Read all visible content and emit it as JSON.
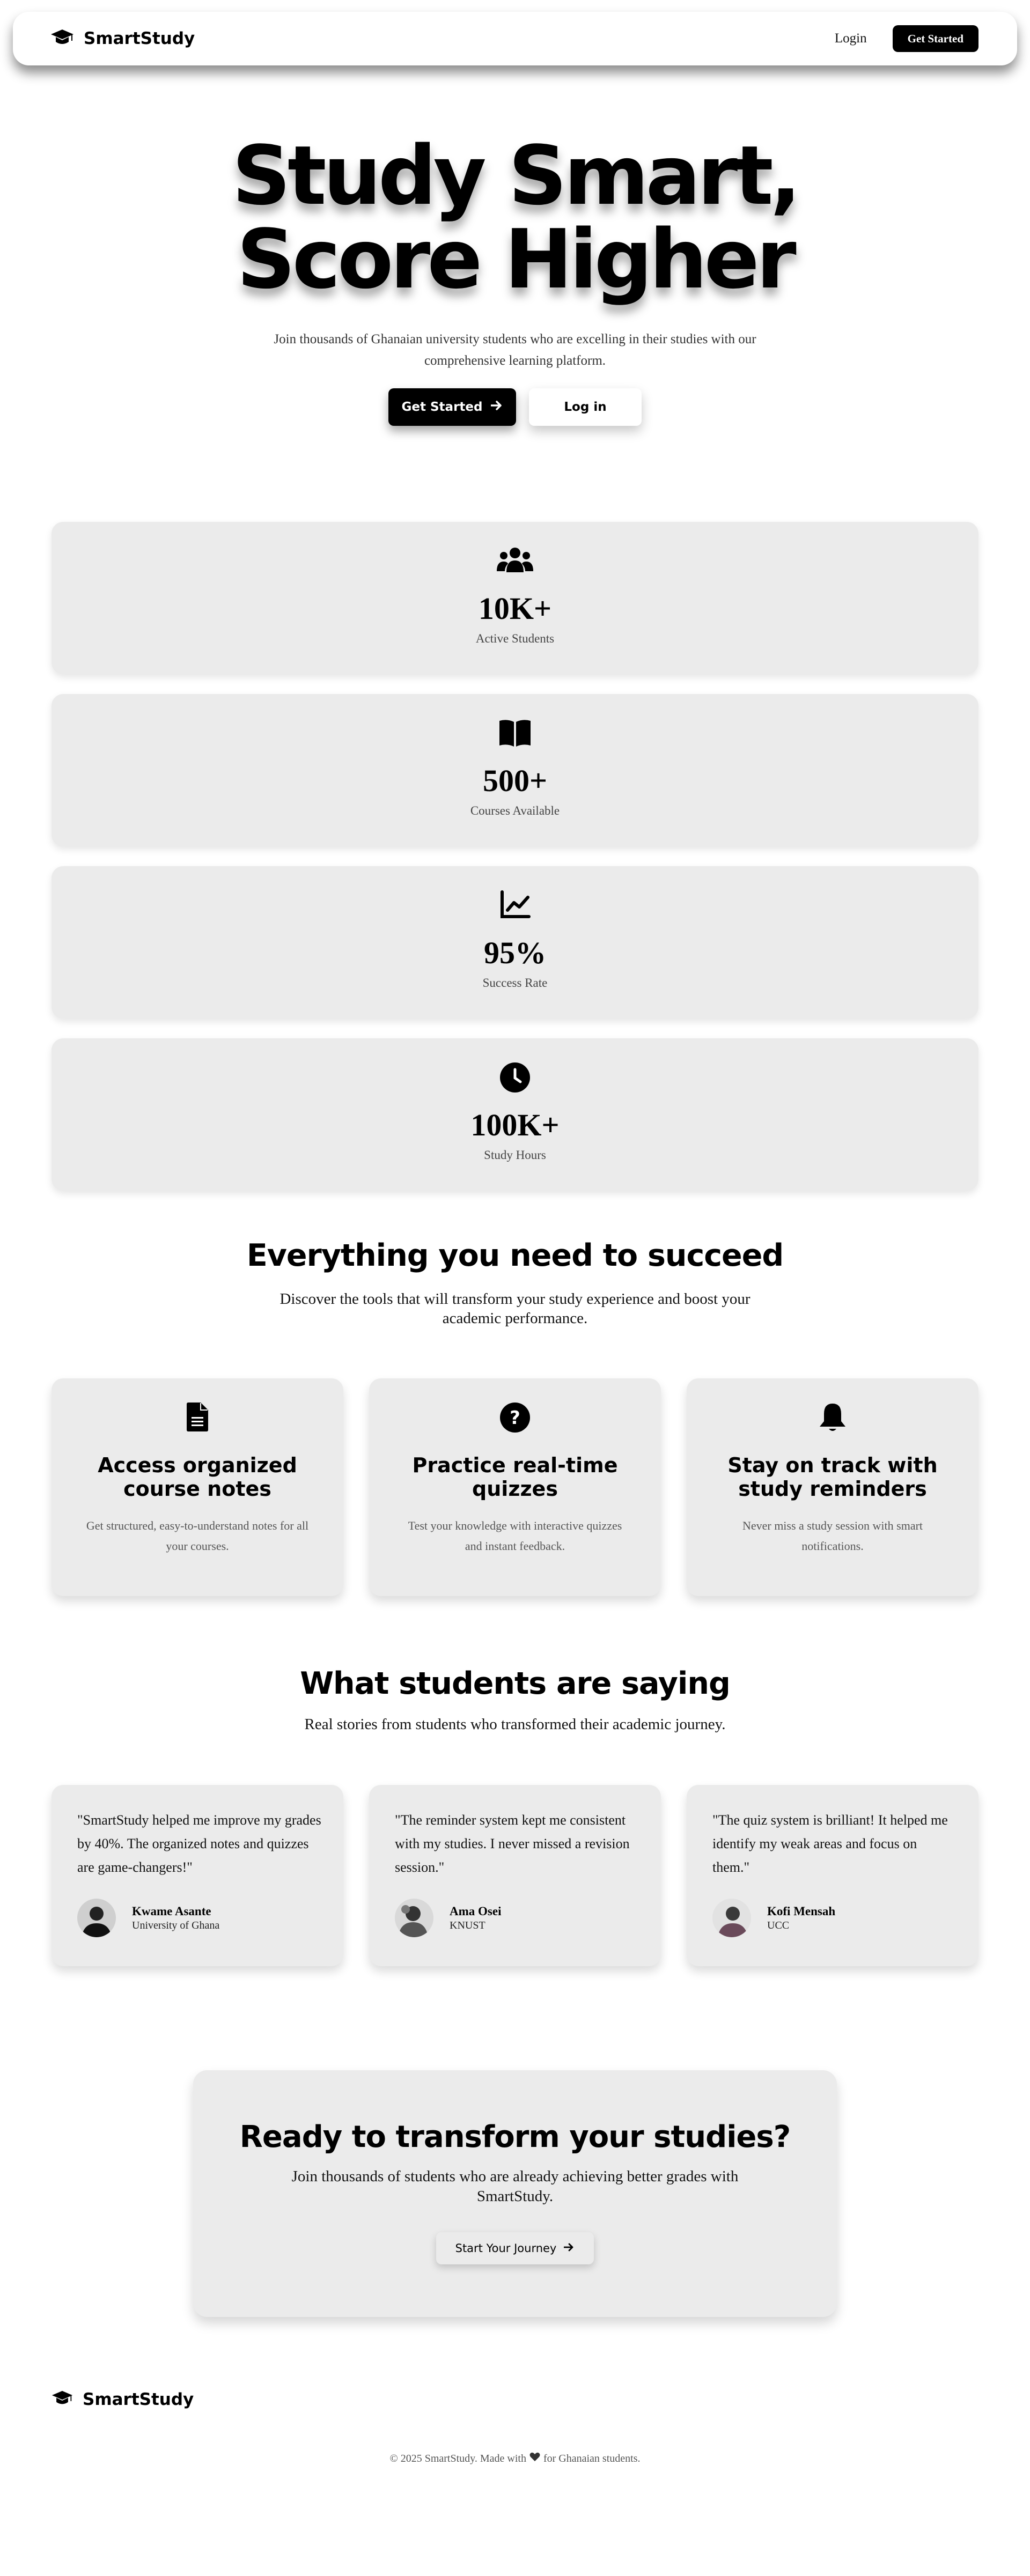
{
  "brand": {
    "name": "SmartStudy",
    "icon": "graduation-cap-icon"
  },
  "nav": {
    "login_label": "Login",
    "cta_label": "Get Started"
  },
  "hero": {
    "title_line1": "Study Smart,",
    "title_line2": "Score Higher",
    "subtitle": "Join thousands of Ghanaian university students who are excelling in their studies with our comprehensive learning platform.",
    "primary_label": "Get Started",
    "secondary_label": "Log in"
  },
  "stats": [
    {
      "icon": "users-icon",
      "value": "10K+",
      "label": "Active Students"
    },
    {
      "icon": "book-open-icon",
      "value": "500+",
      "label": "Courses Available"
    },
    {
      "icon": "chart-line-icon",
      "value": "95%",
      "label": "Success Rate"
    },
    {
      "icon": "clock-icon",
      "value": "100K+",
      "label": "Study Hours"
    }
  ],
  "features": {
    "title": "Everything you need to succeed",
    "subtitle": "Discover the tools that will transform your study experience and boost your academic performance.",
    "items": [
      {
        "icon": "file-text-icon",
        "title": "Access organized course notes",
        "desc": "Get structured, easy-to-understand notes for all your courses."
      },
      {
        "icon": "question-circle-icon",
        "title": "Practice real-time quizzes",
        "desc": "Test your knowledge with interactive quizzes and instant feedback."
      },
      {
        "icon": "bell-icon",
        "title": "Stay on track with study reminders",
        "desc": "Never miss a study session with smart notifications."
      }
    ]
  },
  "testimonials": {
    "title": "What students are saying",
    "subtitle": "Real stories from students who transformed their academic journey.",
    "items": [
      {
        "quote": "\"SmartStudy helped me improve my grades by 40%. The organized notes and quizzes are game-changers!\"",
        "name": "Kwame Asante",
        "school": "University of Ghana"
      },
      {
        "quote": "\"The reminder system kept me consistent with my studies. I never missed a revision session.\"",
        "name": "Ama Osei",
        "school": "KNUST"
      },
      {
        "quote": "\"The quiz system is brilliant! It helped me identify my weak areas and focus on them.\"",
        "name": "Kofi Mensah",
        "school": "UCC"
      }
    ]
  },
  "cta": {
    "title": "Ready to transform your studies?",
    "subtitle": "Join thousands of students who are already achieving better grades with SmartStudy.",
    "button_label": "Start Your Journey"
  },
  "footer": {
    "copy_before": "© 2025 SmartStudy. Made with",
    "copy_after": "for Ghanaian students.",
    "heart_icon": "heart-icon"
  }
}
